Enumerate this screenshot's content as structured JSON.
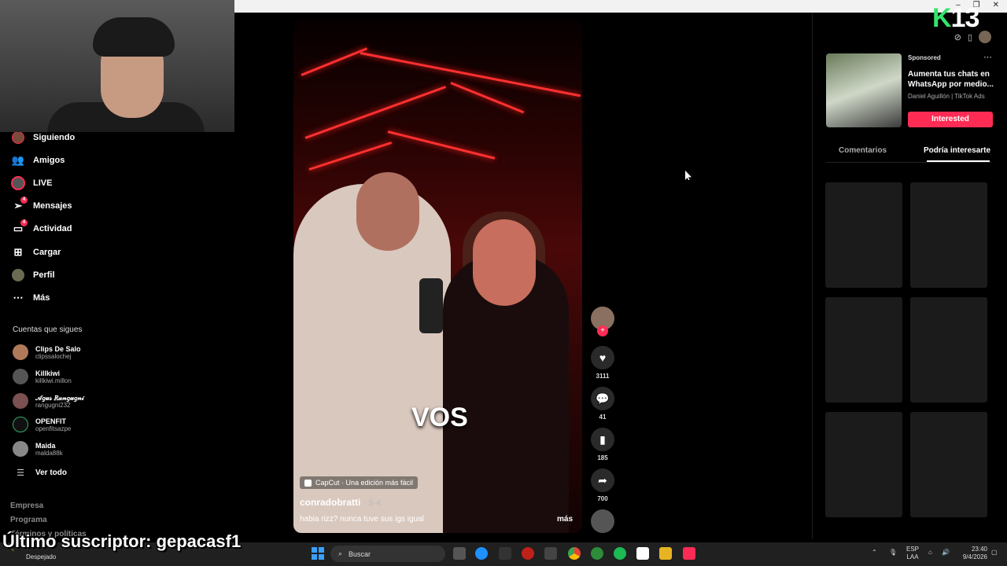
{
  "window": {
    "controls": [
      "–",
      "❐",
      "✕"
    ]
  },
  "sidebar": {
    "nav": [
      {
        "label": "Siguiendo",
        "icon": "following-avatar-icon"
      },
      {
        "label": "Amigos",
        "icon": "friends-icon"
      },
      {
        "label": "LIVE",
        "icon": "live-icon"
      },
      {
        "label": "Mensajes",
        "icon": "messages-icon",
        "badge": "4"
      },
      {
        "label": "Actividad",
        "icon": "activity-icon",
        "badge": "4"
      },
      {
        "label": "Cargar",
        "icon": "upload-icon"
      },
      {
        "label": "Perfil",
        "icon": "profile-avatar-icon"
      },
      {
        "label": "Más",
        "icon": "more-icon"
      }
    ],
    "following_title": "Cuentas que sigues",
    "following": [
      {
        "name": "Clips De Salo",
        "handle": "clipssalochej"
      },
      {
        "name": "Killkiwi",
        "handle": "killkiwi.millon"
      },
      {
        "name": "𝒜𝑔𝓊𝓈 𝑅𝒶𝓃𝑔𝓊𝑔𝓃𝒾",
        "handle": "rangugni232"
      },
      {
        "name": "OPENFIT",
        "handle": "openfitsazpe"
      },
      {
        "name": "Maida",
        "handle": "malda88k"
      }
    ],
    "see_all": "Ver todo",
    "footer": [
      "Empresa",
      "Programa",
      "Términos y políticas"
    ]
  },
  "video": {
    "overlay_word": "VOS",
    "capcut": "CapCut · Una edición más fácil",
    "author": "conradobratti",
    "date": " · 3-4",
    "caption": "habia rizz? nunca tuve sus igs igual",
    "more": "más"
  },
  "actions": {
    "likes": "3111",
    "comments": "41",
    "saves": "185",
    "shares": "700"
  },
  "ad": {
    "sponsored": "Sponsored",
    "title": "Aumenta tus chats en WhatsApp por medio...",
    "by": "Daniel Aguillón | TikTok Ads",
    "button": "Interested"
  },
  "tabs": {
    "comments": "Comentarios",
    "suggested": "Podría interesarte"
  },
  "stream": {
    "logo_letter": "K",
    "logo_number": "13",
    "subscriber": "Último suscriptor: gepacasf1"
  },
  "taskbar": {
    "weather": "Despejado",
    "search": "Buscar",
    "lang_top": "ESP",
    "lang_bottom": "LAA",
    "time": "23:40",
    "date": "9/4/2026"
  },
  "colors": {
    "accent": "#fe2c55",
    "logo": "#35e36a",
    "background": "#000000"
  }
}
